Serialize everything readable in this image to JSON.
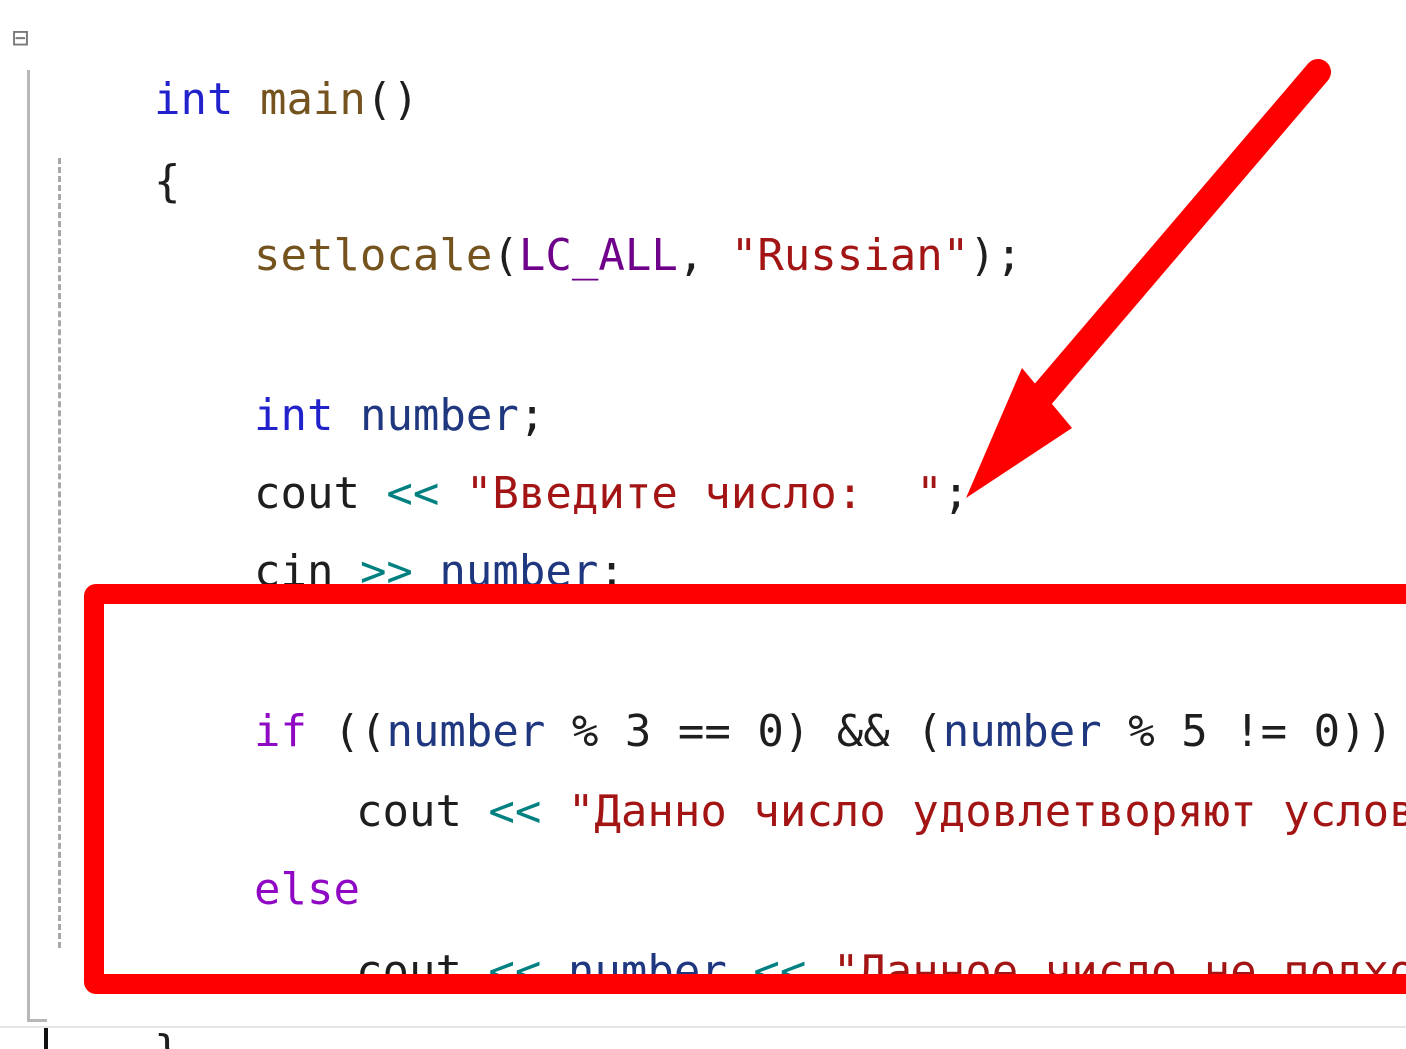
{
  "editor": {
    "fold_symbol": "⊟",
    "lines": {
      "main_sig": {
        "kw": "int",
        "space": " ",
        "fn": "main",
        "paren": "()"
      },
      "open_brace": "{",
      "setlocale": {
        "fn": "setlocale",
        "open": "(",
        "macro": "LC_ALL",
        "comma": ", ",
        "str": "\"Russian\"",
        "close": ");"
      },
      "decl": {
        "kw": "int",
        "space": " ",
        "var": "number",
        "semi": ";"
      },
      "cout1": {
        "id": "cout",
        "op": " << ",
        "str": "\"Введите число:  \"",
        "semi": ";"
      },
      "cin": {
        "id": "cin",
        "op": " >> ",
        "var": "number",
        "semi": ";"
      },
      "if": {
        "kw": "if",
        "p1": " ((",
        "var1": "number",
        "cond1": " % 3 == 0)",
        "and": " && ",
        "p2": "(",
        "var2": "number",
        "cond2": " % 5 != 0))"
      },
      "cout2": {
        "id": "cout",
        "op": " << ",
        "str": "\"Данно число удовлетворяют условию.\"",
        "semi": ";"
      },
      "else": "else",
      "cout3": {
        "id": "cout",
        "op1": " << ",
        "var": "number",
        "op2": " << ",
        "str": "\"Данное число не подходит.\"",
        "semi": ";"
      },
      "close_brace": "}"
    }
  },
  "colors": {
    "annotation": "#ff0000",
    "keyword": "#2222cc",
    "control_keyword": "#8f08c4",
    "function": "#74531f",
    "macro": "#6f008a",
    "string": "#a31515",
    "variable": "#1f377f"
  },
  "icons": {
    "fold_toggle": "collapse-minus-icon",
    "arrow": "red-arrow-annotation"
  }
}
